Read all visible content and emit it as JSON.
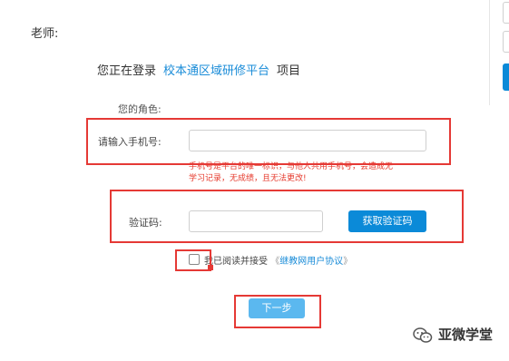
{
  "header": {
    "teacher_label": "老师:"
  },
  "login": {
    "prefix": "您正在登录",
    "platform": "校本通区域研修平台",
    "suffix": "项目"
  },
  "form": {
    "role_label": "您的角色:",
    "phone_label": "请输入手机号:",
    "phone_value": "",
    "warning_line1": "手机号是平台的唯一标识，与他人共用手机号，会造成无",
    "warning_line2": "学习记录，无成绩，且无法更改!",
    "code_label": "验证码:",
    "code_value": "",
    "sms_button": "获取验证码",
    "agree_prefix": "我已阅读并接受",
    "agree_open": "《",
    "agree_link": "继教网用户协议",
    "agree_close": "》",
    "next_button": "下一步"
  },
  "watermark": {
    "text": "亚微学堂",
    "icon": "wechat-icon"
  },
  "colors": {
    "accent": "#0b8ad8",
    "next_button": "#5bb8ef",
    "warning": "#e63a2c",
    "annotation": "#e53935"
  }
}
